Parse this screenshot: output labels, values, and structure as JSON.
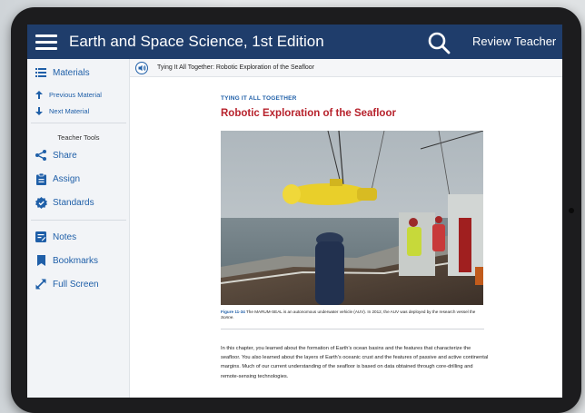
{
  "header": {
    "title": "Earth and Space Science, 1st Edition",
    "review_label": "Review Teacher",
    "bar_color": "#1f3d6b"
  },
  "sidebar": {
    "materials": "Materials",
    "previous": "Previous Material",
    "next": "Next Material",
    "tools_heading": "Teacher Tools",
    "share": "Share",
    "assign": "Assign",
    "standards": "Standards",
    "notes": "Notes",
    "bookmarks": "Bookmarks",
    "fullscreen": "Full Screen",
    "link_color": "#1f5fa8"
  },
  "audio": {
    "title": "Tying It All Together: Robotic Exploration of the Seafloor"
  },
  "article": {
    "kicker": "TYING IT ALL TOGETHER",
    "heading": "Robotic Exploration of the Seafloor",
    "heading_color": "#b7222c",
    "caption_fig": "Figure 11-34",
    "caption_text": " The MARUM-SEAL is an autonomous underwater vehicle (AUV). In 2012, the AUV was deployed by the research vessel the ",
    "caption_vessel": "Sonne",
    "caption_end": ".",
    "body": "In this chapter, you learned about the formation of Earth’s ocean basins and the features that characterize the seafloor. You also learned about the layers of Earth’s oceanic crust and the features of passive and active continental margins. Much of our current understanding of the seafloor is based on data obtained through core-drilling and remote-sensing technologies."
  }
}
